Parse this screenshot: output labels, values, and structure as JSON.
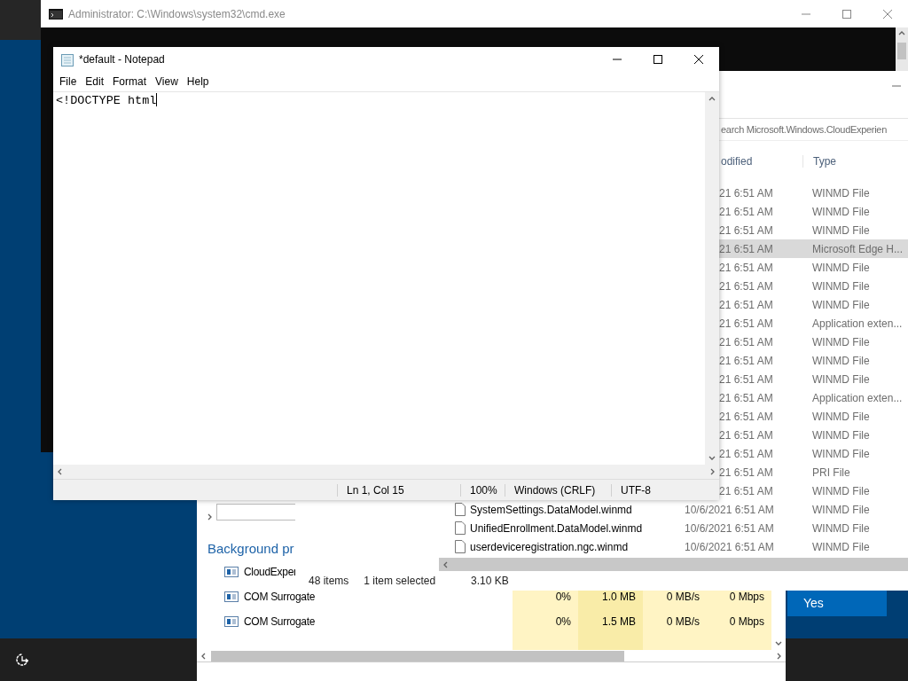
{
  "cmd_window": {
    "title": "Administrator: C:\\Windows\\system32\\cmd.exe"
  },
  "notepad": {
    "title": "*default - Notepad",
    "menu": [
      "File",
      "Edit",
      "Format",
      "View",
      "Help"
    ],
    "text": "<!DOCTYPE html",
    "status": [
      "Ln 1, Col 15",
      "100%",
      "Windows (CRLF)",
      "UTF-8"
    ]
  },
  "explorer": {
    "search": {
      "placeholder": "earch Microsoft.Windows.CloudExperien"
    },
    "columns": [
      "odified",
      "Type"
    ],
    "rows": [
      {
        "modified": "21 6:51 AM",
        "type": "WINMD File",
        "selected": false
      },
      {
        "modified": "21 6:51 AM",
        "type": "WINMD File",
        "selected": false
      },
      {
        "modified": "21 6:51 AM",
        "type": "WINMD File",
        "selected": false
      },
      {
        "modified": "21 6:51 AM",
        "type": "Microsoft Edge H...",
        "selected": true
      },
      {
        "modified": "21 6:51 AM",
        "type": "WINMD File",
        "selected": false
      },
      {
        "modified": "21 6:51 AM",
        "type": "WINMD File",
        "selected": false
      },
      {
        "modified": "21 6:51 AM",
        "type": "WINMD File",
        "selected": false
      },
      {
        "modified": "21 6:51 AM",
        "type": "Application exten...",
        "selected": false
      },
      {
        "modified": "21 6:51 AM",
        "type": "WINMD File",
        "selected": false
      },
      {
        "modified": "21 6:51 AM",
        "type": "WINMD File",
        "selected": false
      },
      {
        "modified": "21 6:51 AM",
        "type": "WINMD File",
        "selected": false
      },
      {
        "modified": "21 6:51 AM",
        "type": "Application exten...",
        "selected": false
      },
      {
        "modified": "21 6:51 AM",
        "type": "WINMD File",
        "selected": false
      },
      {
        "modified": "21 6:51 AM",
        "type": "WINMD File",
        "selected": false
      },
      {
        "modified": "21 6:51 AM",
        "type": "WINMD File",
        "selected": false
      },
      {
        "modified": "21 6:51 AM",
        "type": "PRI File",
        "selected": false
      },
      {
        "modified": "21 6:51 AM",
        "type": "WINMD File",
        "selected": false
      },
      {
        "name": "SystemSettings.DataModel.winmd",
        "modified": "10/6/2021 6:51 AM",
        "type": "WINMD File",
        "selected": false
      },
      {
        "name": "UnifiedEnrollment.DataModel.winmd",
        "modified": "10/6/2021 6:51 AM",
        "type": "WINMD File",
        "selected": false
      },
      {
        "name": "userdeviceregistration.ngc.winmd",
        "modified": "10/6/2021 6:51 AM",
        "type": "WINMD File",
        "selected": false
      }
    ],
    "status": [
      "48 items",
      "1 item selected",
      "3.10 KB"
    ]
  },
  "task_manager": {
    "heading": "Background pr",
    "processes": [
      {
        "name": "CloudExper"
      },
      {
        "name": "COM Surrogate",
        "cpu": "0%",
        "memory": "1.0 MB",
        "disk": "0 MB/s",
        "network": "0 Mbps"
      },
      {
        "name": "COM Surrogate",
        "cpu": "0%",
        "memory": "1.5 MB",
        "disk": "0 MB/s",
        "network": "0 Mbps"
      }
    ]
  },
  "dialog": {
    "button": "Yes"
  }
}
